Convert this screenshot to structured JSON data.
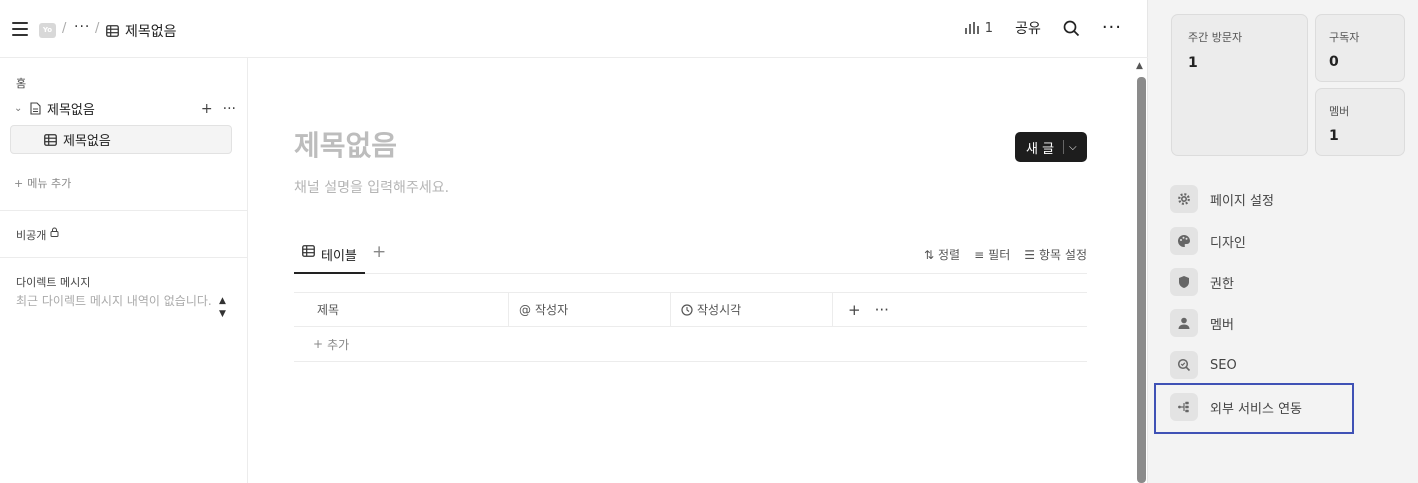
{
  "topbar": {
    "workspace_logo": "Yo",
    "breadcrumb_sep": "/",
    "breadcrumb_more": "···",
    "page_title": "제목없음",
    "views_count": "1",
    "share_label": "공유",
    "more_label": "···"
  },
  "sidebar": {
    "home": "홈",
    "page": {
      "label": "제목없음",
      "add": "+",
      "more": "···"
    },
    "subpage": {
      "label": "제목없음"
    },
    "add_menu": "메뉴 추가",
    "private": "비공개",
    "dm_title": "다이렉트 메시지",
    "dm_empty": "최근 다이렉트 메시지 내역이 없습니다."
  },
  "main": {
    "title": "제목없음",
    "description": "채널 설명을 입력해주세요.",
    "new_post": "새 글",
    "tabs": [
      {
        "label": "테이블",
        "icon": "table-icon"
      }
    ],
    "tab_add": "+",
    "tools": {
      "sort": "정렬",
      "filter": "필터",
      "fields": "항목 설정"
    },
    "table": {
      "columns": [
        {
          "label": "제목",
          "icon": ""
        },
        {
          "label": "작성자",
          "icon": "at-icon"
        },
        {
          "label": "작성시각",
          "icon": "clock-icon"
        }
      ],
      "add_column": "+",
      "more": "···",
      "add_row": "추가"
    }
  },
  "stats": {
    "weekly_visitors": {
      "label": "주간 방문자",
      "value": "1"
    },
    "subscribers": {
      "label": "구독자",
      "value": "0"
    },
    "members": {
      "label": "멤버",
      "value": "1"
    }
  },
  "settings_menu": [
    {
      "label": "페이지 설정",
      "icon": "gear-icon"
    },
    {
      "label": "디자인",
      "icon": "palette-icon"
    },
    {
      "label": "권한",
      "icon": "shield-icon"
    },
    {
      "label": "멤버",
      "icon": "person-icon"
    },
    {
      "label": "SEO",
      "icon": "seo-icon"
    },
    {
      "label": "외부 서비스 연동",
      "icon": "integration-icon"
    }
  ],
  "colors": {
    "accent_dark": "#1d1d1d",
    "highlight_border": "#3f51b5"
  }
}
